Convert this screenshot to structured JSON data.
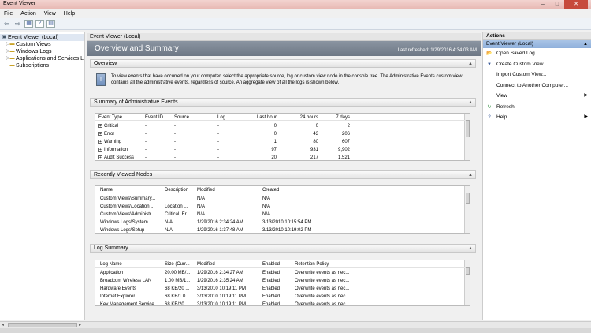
{
  "window": {
    "title": "Event Viewer",
    "controls": [
      "–",
      "□",
      "✕"
    ]
  },
  "menu": [
    "File",
    "Action",
    "View",
    "Help"
  ],
  "toolbar": [
    "⇦",
    "⇨",
    "▦",
    "?",
    "▤"
  ],
  "tree": [
    {
      "label": "Event Viewer (Local)",
      "level": 0,
      "expander": "",
      "icon": "▣",
      "selected": true
    },
    {
      "label": "Custom Views",
      "level": 1,
      "expander": "▷",
      "icon": "▬"
    },
    {
      "label": "Windows Logs",
      "level": 1,
      "expander": "▷",
      "icon": "▬"
    },
    {
      "label": "Applications and Services Lo",
      "level": 1,
      "expander": "▷",
      "icon": "▬"
    },
    {
      "label": "Subscriptions",
      "level": 1,
      "expander": "",
      "icon": "▬"
    }
  ],
  "center": {
    "header": "Event Viewer (Local)",
    "banner_title": "Overview and Summary",
    "last_refreshed": "Last refreshed: 1/29/2016 4:34:03 AM",
    "overview": {
      "title": "Overview",
      "text": "To view events that have occurred on your computer, select the appropriate source, log or custom view node in the console tree. The Administrative Events custom view contains all the administrative events, regardless of source. An aggregate view of all the logs is shown below."
    },
    "summary": {
      "title": "Summary of Administrative Events",
      "columns": [
        "Event Type",
        "Event ID",
        "Source",
        "Log",
        "Last hour",
        "24 hours",
        "7 days"
      ],
      "rows": [
        [
          "Critical",
          "-",
          "-",
          "-",
          "0",
          "0",
          "2"
        ],
        [
          "Error",
          "-",
          "-",
          "-",
          "0",
          "43",
          "206"
        ],
        [
          "Warning",
          "-",
          "-",
          "-",
          "1",
          "80",
          "607"
        ],
        [
          "Information",
          "-",
          "-",
          "-",
          "97",
          "931",
          "9,902"
        ],
        [
          "Audit Success",
          "-",
          "-",
          "-",
          "20",
          "217",
          "1,521"
        ]
      ]
    },
    "recent": {
      "title": "Recently Viewed Nodes",
      "columns": [
        "Name",
        "Description",
        "Modified",
        "Created"
      ],
      "rows": [
        [
          "Custom Views\\Summary...",
          "",
          "N/A",
          "N/A"
        ],
        [
          "Custom Views\\Location ...",
          "Location ...",
          "N/A",
          "N/A"
        ],
        [
          "Custom Views\\Administr...",
          "Critical, Er...",
          "N/A",
          "N/A"
        ],
        [
          "Windows Logs\\System",
          "N/A",
          "1/29/2016 2:34:24 AM",
          "3/13/2010 10:15:54 PM"
        ],
        [
          "Windows Logs\\Setup",
          "N/A",
          "1/29/2016 1:37:48 AM",
          "3/13/2010 10:19:02 PM"
        ]
      ]
    },
    "logsummary": {
      "title": "Log Summary",
      "columns": [
        "Log Name",
        "Size (Curr...",
        "Modified",
        "Enabled",
        "Retention Policy"
      ],
      "rows": [
        [
          "Application",
          "20.00 MB/...",
          "1/29/2016 2:34:27 AM",
          "Enabled",
          "Overwrite events as nec..."
        ],
        [
          "Broadcom Wireless LAN",
          "1.00 MB/1...",
          "1/29/2016 2:35:24 AM",
          "Enabled",
          "Overwrite events as nec..."
        ],
        [
          "Hardware Events",
          "68 KB/20 ...",
          "3/13/2010 10:19:11 PM",
          "Enabled",
          "Overwrite events as nec..."
        ],
        [
          "Internet Explorer",
          "68 KB/1.0...",
          "3/13/2010 10:19:11 PM",
          "Enabled",
          "Overwrite events as nec..."
        ],
        [
          "Key Management Service",
          "68 KB/20 ...",
          "3/13/2010 10:19:11 PM",
          "Enabled",
          "Overwrite events as nec..."
        ]
      ]
    }
  },
  "actions": {
    "title": "Actions",
    "context": "Event Viewer (Local)",
    "items": [
      {
        "label": "Open Saved Log...",
        "icon": "📂"
      },
      {
        "label": "Create Custom View...",
        "icon": "▼"
      },
      {
        "label": "Import Custom View...",
        "icon": ""
      },
      {
        "label": "Connect to Another Computer...",
        "icon": ""
      },
      {
        "label": "View",
        "icon": "",
        "submenu": true
      },
      {
        "label": "Refresh",
        "icon": "↻"
      },
      {
        "label": "Help",
        "icon": "?",
        "submenu": true
      }
    ]
  },
  "colors": {
    "titlebar": "#e8b9b4",
    "banner": "#7a8491",
    "selection": "#8fb0db"
  }
}
